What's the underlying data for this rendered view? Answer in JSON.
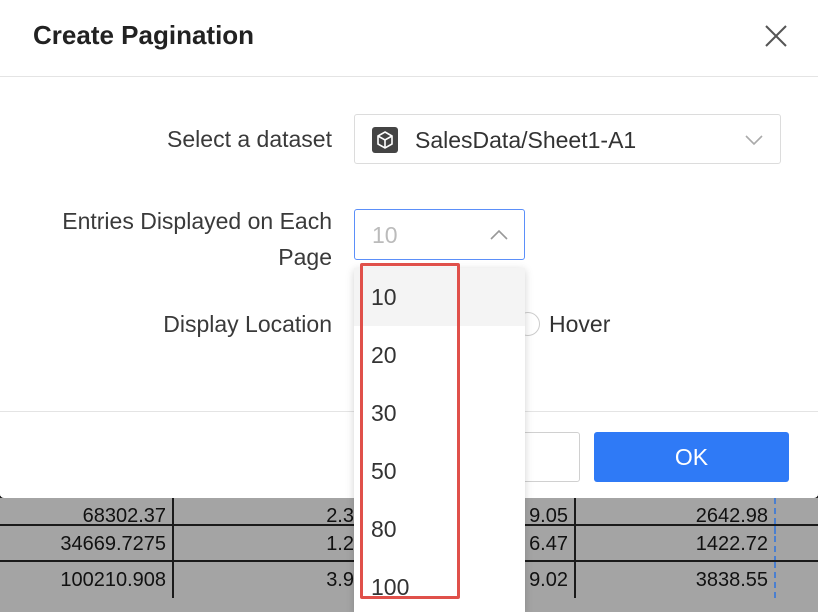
{
  "dialog": {
    "title": "Create Pagination",
    "close_label": "close"
  },
  "form": {
    "dataset_label": "Select a dataset",
    "dataset_value": "SalesData/Sheet1-A1",
    "entries_label": "Entries Displayed on Each Page",
    "entries_value": "10",
    "location_label": "Display Location",
    "location_option": "Hover"
  },
  "dropdown": {
    "options": [
      "10",
      "20",
      "30",
      "50",
      "80",
      "100"
    ],
    "selected": "10"
  },
  "footer": {
    "ok_label": "OK"
  },
  "background_sheet": {
    "rows": [
      [
        "68302.37",
        "2.3",
        "9.05",
        "2642.98"
      ],
      [
        "34669.7275",
        "1.2",
        "6.47",
        "1422.72"
      ],
      [
        "100210.908",
        "3.9",
        "9.02",
        "3838.55"
      ]
    ]
  },
  "colors": {
    "primary": "#2f7af6",
    "highlight": "#e0504a",
    "focus_border": "#5b8ff9"
  }
}
